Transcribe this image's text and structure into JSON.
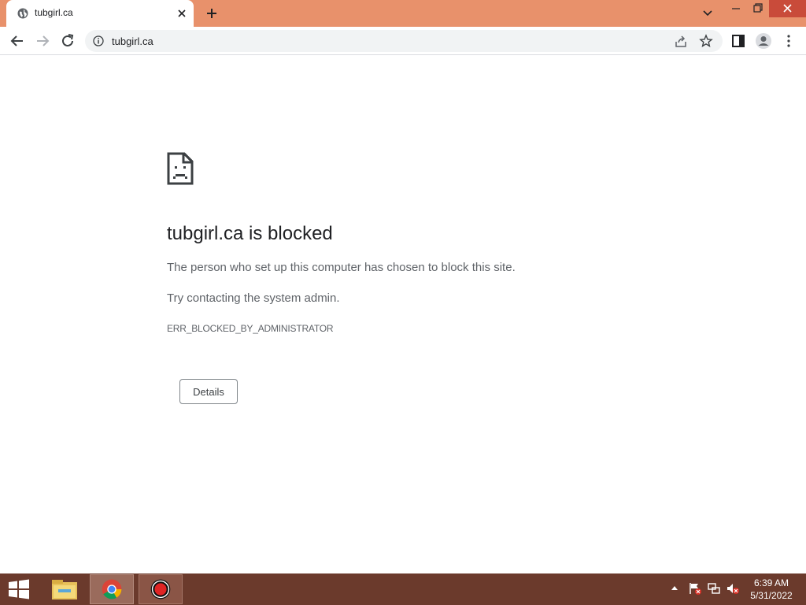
{
  "browser": {
    "tab_title": "tubgirl.ca",
    "url": "tubgirl.ca"
  },
  "page": {
    "title": "tubgirl.ca is blocked",
    "description": "The person who set up this computer has chosen to block this site.",
    "hint": "Try contacting the system admin.",
    "error_code": "ERR_BLOCKED_BY_ADMINISTRATOR",
    "details_label": "Details"
  },
  "taskbar": {
    "time": "6:39 AM",
    "date": "5/31/2022",
    "apps": [
      "file-explorer",
      "chrome",
      "recorder"
    ]
  },
  "colors": {
    "titlebar": "#e8916b",
    "taskbar": "#6b3a2c",
    "close_button": "#c94b3a"
  }
}
